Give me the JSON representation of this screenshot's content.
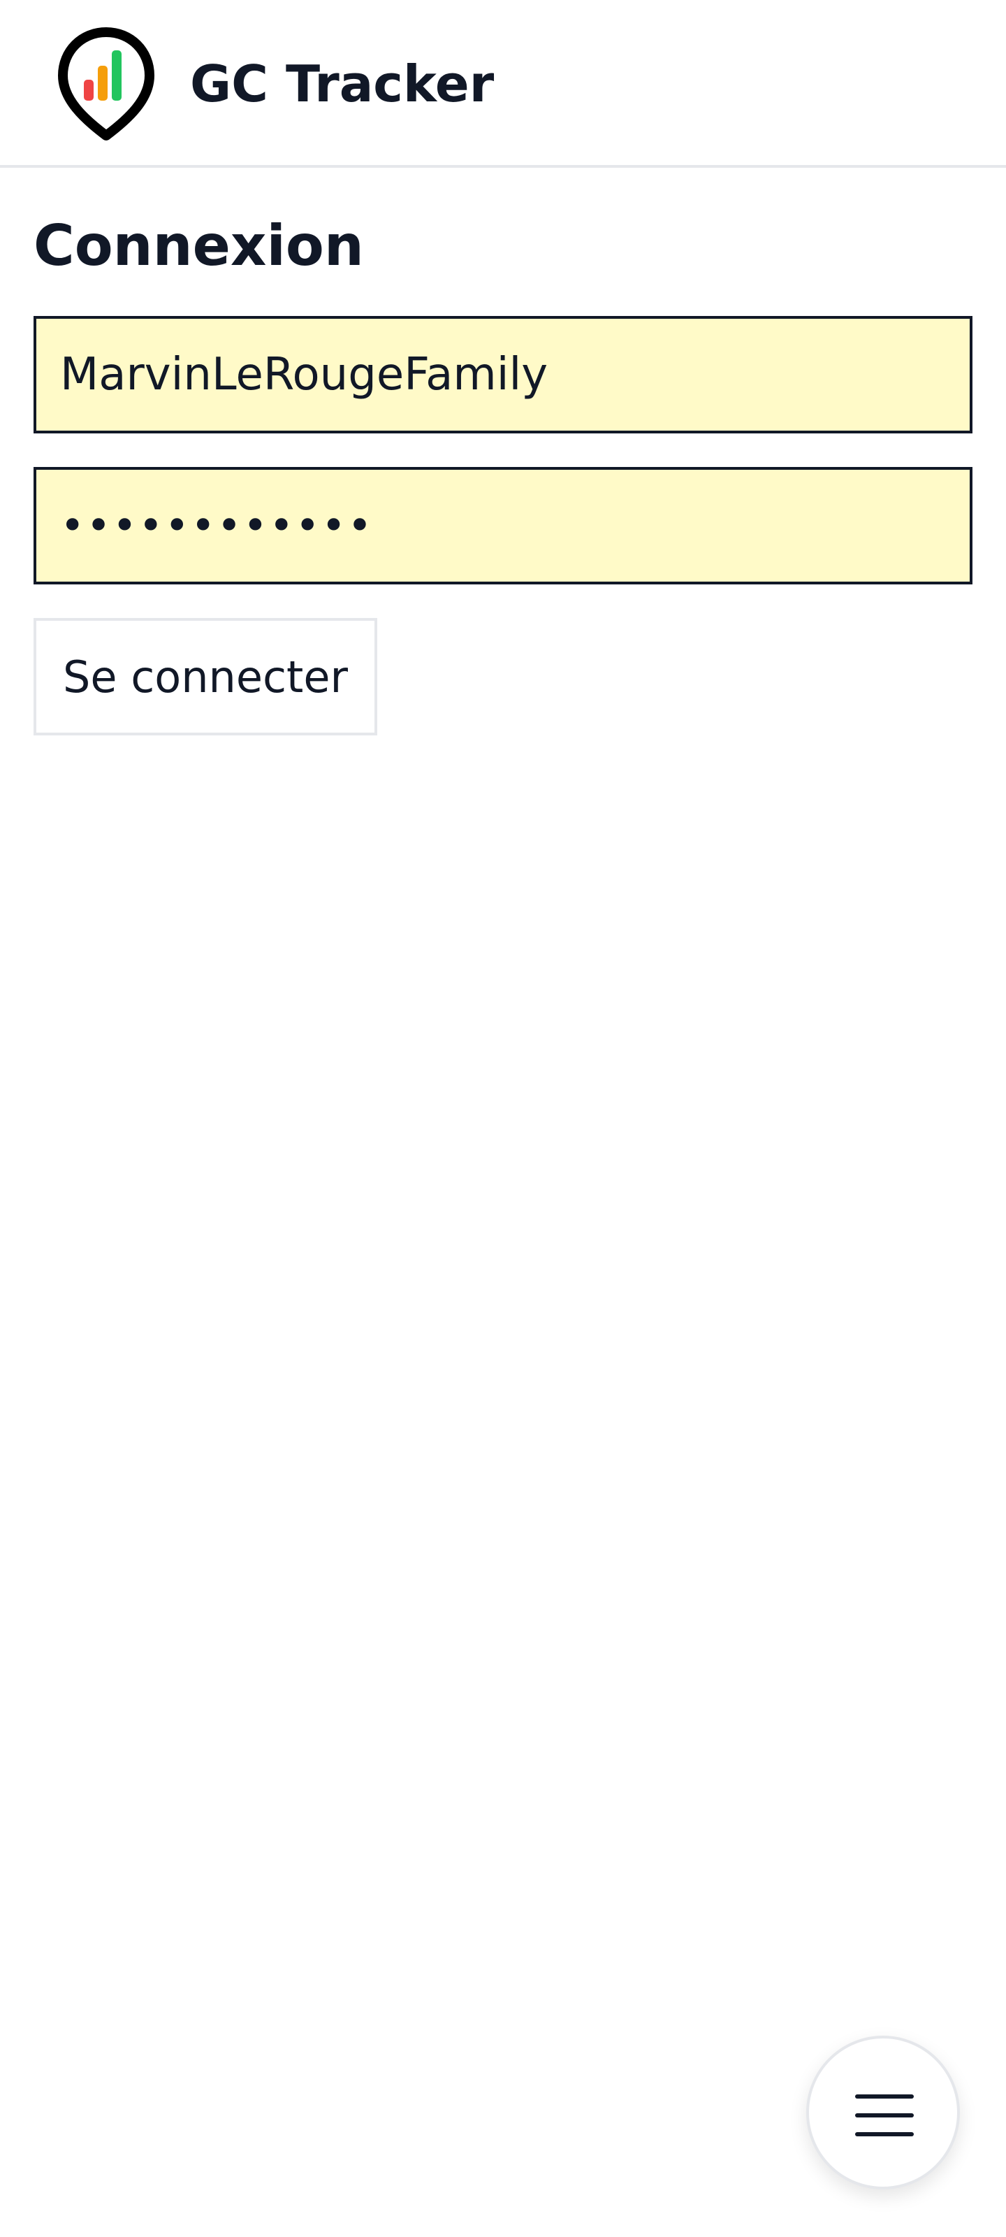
{
  "header": {
    "app_name": "GC Tracker",
    "logo_icon": "map-pin-chart-icon"
  },
  "login": {
    "title": "Connexion",
    "username_value": "MarvinLeRougeFamily",
    "password_value": "••••••••••••",
    "submit_label": "Se connecter"
  },
  "fab": {
    "icon": "hamburger-menu-icon"
  },
  "colors": {
    "input_background": "#fffac8",
    "text": "#111827",
    "border_light": "#e5e7eb",
    "logo_red": "#ef4444",
    "logo_orange": "#f59e0b",
    "logo_green": "#22c55e"
  }
}
